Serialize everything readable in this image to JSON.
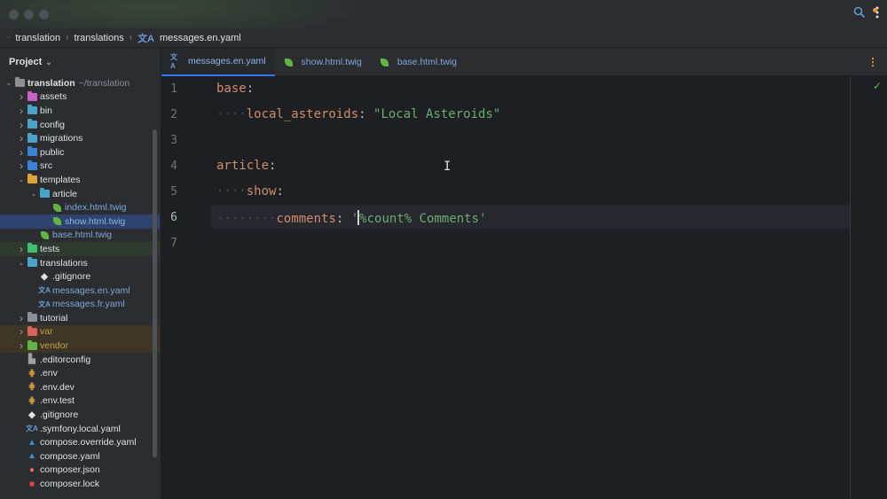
{
  "breadcrumb": {
    "items": [
      "translation",
      "translations",
      "messages.en.yaml"
    ]
  },
  "project": {
    "header": "Project",
    "tree": [
      {
        "label": "translation",
        "extra": "~/translation",
        "icon": "module-folder-icon",
        "expanded": true,
        "level": 0
      },
      {
        "label": "assets",
        "icon": "folder-icon",
        "color": "#c563c5",
        "expanded": false,
        "level": 1
      },
      {
        "label": "bin",
        "icon": "folder-icon",
        "color": "#4aa3c9",
        "expanded": false,
        "level": 1
      },
      {
        "label": "config",
        "icon": "folder-icon",
        "color": "#4aa3c9",
        "expanded": false,
        "level": 1
      },
      {
        "label": "migrations",
        "icon": "folder-icon",
        "color": "#4aa3c9",
        "expanded": false,
        "level": 1
      },
      {
        "label": "public",
        "icon": "folder-icon",
        "color": "#3b82d6",
        "expanded": false,
        "level": 1
      },
      {
        "label": "src",
        "icon": "folder-icon",
        "color": "#3b82d6",
        "expanded": false,
        "level": 1
      },
      {
        "label": "templates",
        "icon": "folder-icon",
        "color": "#e0a338",
        "expanded": true,
        "level": 1
      },
      {
        "label": "article",
        "icon": "folder-icon",
        "color": "#4aa3c9",
        "expanded": true,
        "level": 2
      },
      {
        "label": "index.html.twig",
        "icon": "twig-file-icon",
        "level": 3,
        "style": "twig"
      },
      {
        "label": "show.html.twig",
        "icon": "twig-file-icon",
        "level": 3,
        "style": "twig",
        "selected": true
      },
      {
        "label": "base.html.twig",
        "icon": "twig-file-icon",
        "level": 2,
        "style": "twig"
      },
      {
        "label": "tests",
        "icon": "folder-icon",
        "color": "#3fbf6f",
        "expanded": false,
        "level": 1,
        "highlight": "green"
      },
      {
        "label": "translations",
        "icon": "folder-icon",
        "color": "#4aa3c9",
        "expanded": true,
        "level": 1
      },
      {
        "label": ".gitignore",
        "icon": "gitignore-file-icon",
        "level": 2
      },
      {
        "label": "messages.en.yaml",
        "icon": "yaml-file-icon",
        "level": 2,
        "style": "twig"
      },
      {
        "label": "messages.fr.yaml",
        "icon": "yaml-file-icon",
        "level": 2,
        "style": "twig"
      },
      {
        "label": "tutorial",
        "icon": "folder-icon",
        "color": "#8c8f94",
        "expanded": false,
        "level": 1
      },
      {
        "label": "var",
        "icon": "folder-icon",
        "color": "#d7625a",
        "expanded": false,
        "level": 1,
        "excluded": true
      },
      {
        "label": "vendor",
        "icon": "folder-icon",
        "color": "#62b543",
        "expanded": false,
        "level": 1,
        "excluded": true
      },
      {
        "label": ".editorconfig",
        "icon": "config-file-icon",
        "level": 1
      },
      {
        "label": ".env",
        "icon": "env-file-icon",
        "level": 1
      },
      {
        "label": ".env.dev",
        "icon": "env-file-icon",
        "level": 1
      },
      {
        "label": ".env.test",
        "icon": "env-file-icon",
        "level": 1
      },
      {
        "label": ".gitignore",
        "icon": "gitignore-file-icon",
        "level": 1
      },
      {
        "label": ".symfony.local.yaml",
        "icon": "yaml-file-icon",
        "level": 1
      },
      {
        "label": "compose.override.yaml",
        "icon": "docker-file-icon",
        "level": 1
      },
      {
        "label": "compose.yaml",
        "icon": "docker-file-icon",
        "level": 1
      },
      {
        "label": "composer.json",
        "icon": "composer-file-icon",
        "level": 1
      },
      {
        "label": "composer.lock",
        "icon": "lock-file-icon",
        "level": 1
      }
    ]
  },
  "tabs": [
    {
      "label": "messages.en.yaml",
      "icon": "yaml-file-icon",
      "active": true
    },
    {
      "label": "show.html.twig",
      "icon": "twig-file-icon",
      "active": false
    },
    {
      "label": "base.html.twig",
      "icon": "twig-file-icon",
      "active": false
    }
  ],
  "editor": {
    "current_line": 6,
    "lines": [
      {
        "n": "1",
        "indent": "",
        "key": "base",
        "colon": ":",
        "value": ""
      },
      {
        "n": "2",
        "indent": "····",
        "key": "local_asteroids",
        "colon": ": ",
        "value": "\"Local Asteroids\""
      },
      {
        "n": "3",
        "indent": "",
        "key": "",
        "colon": "",
        "value": ""
      },
      {
        "n": "4",
        "indent": "",
        "key": "article",
        "colon": ":",
        "value": ""
      },
      {
        "n": "5",
        "indent": "····",
        "key": "show",
        "colon": ":",
        "value": ""
      },
      {
        "n": "6",
        "indent": "········",
        "key": "comments",
        "colon": ": ",
        "value": "'%count% Comments'"
      },
      {
        "n": "7",
        "indent": "",
        "key": "",
        "colon": "",
        "value": ""
      }
    ]
  },
  "colors": {
    "accent": "#3574f0",
    "key": "#cf8e6d",
    "string": "#6aab73",
    "twig": "#62b543"
  }
}
